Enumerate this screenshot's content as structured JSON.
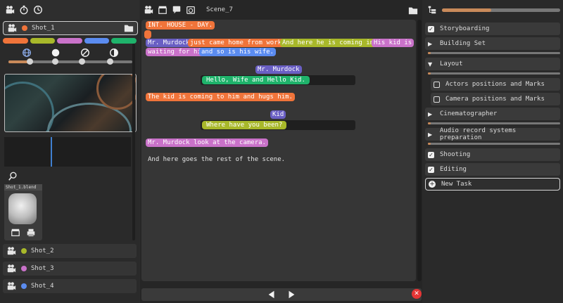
{
  "colors": {
    "orange": "#f0743a",
    "olive": "#a8b82a",
    "pink": "#c972c9",
    "blue": "#5b8cf0",
    "green": "#1fb36b",
    "purple": "#6a5fc4",
    "red": "#e53535",
    "accent": "#c98a5a"
  },
  "left": {
    "icons": [
      "camera-icon",
      "stopwatch-icon",
      "clock-icon"
    ],
    "active_shot": "Shot_1",
    "blend_file": "Shot_1.blend",
    "shots": [
      {
        "label": "Shot_2",
        "color": "#a8b82a"
      },
      {
        "label": "Shot_3",
        "color": "#c972c9"
      },
      {
        "label": "Shot_4",
        "color": "#5b8cf0"
      }
    ]
  },
  "middle": {
    "scene": "Scene_7",
    "lines": {
      "heading": "INT. HOUSE - DAY.",
      "char_mr_murdock": "Mr. Murdock",
      "action1_a": "just came home from work.",
      "action1_b": "And here he is coming in.",
      "action1_c": "His kid is",
      "action1_d": "waiting for him",
      "action1_e": "and so is his wife.",
      "speaker1": "Mr. Murdock",
      "dialog1": "Hello, Wife and Hello Kid.",
      "action2": "The kid is coming to him and hugs him.",
      "speaker2": "Kid",
      "dialog2": "Where have you been?",
      "action3": "Mr. Murdock look at the camera.",
      "action4": "And here goes the rest of the scene."
    }
  },
  "right": {
    "progress": 0.42,
    "tasks": [
      {
        "label": "Storyboarding",
        "state": "checked"
      },
      {
        "label": "Building Set",
        "state": "collapsed"
      },
      {
        "label": "Layout",
        "state": "expanded"
      },
      {
        "label": "Actors positions and Marks",
        "state": "unchecked"
      },
      {
        "label": "Camera positions and Marks",
        "state": "unchecked"
      },
      {
        "label": "Cinematographer",
        "state": "collapsed"
      },
      {
        "label": "Audio record systems preparation",
        "state": "collapsed"
      },
      {
        "label": "Shooting",
        "state": "checked"
      },
      {
        "label": "Editing",
        "state": "checked"
      }
    ],
    "new_task": "New Task"
  }
}
